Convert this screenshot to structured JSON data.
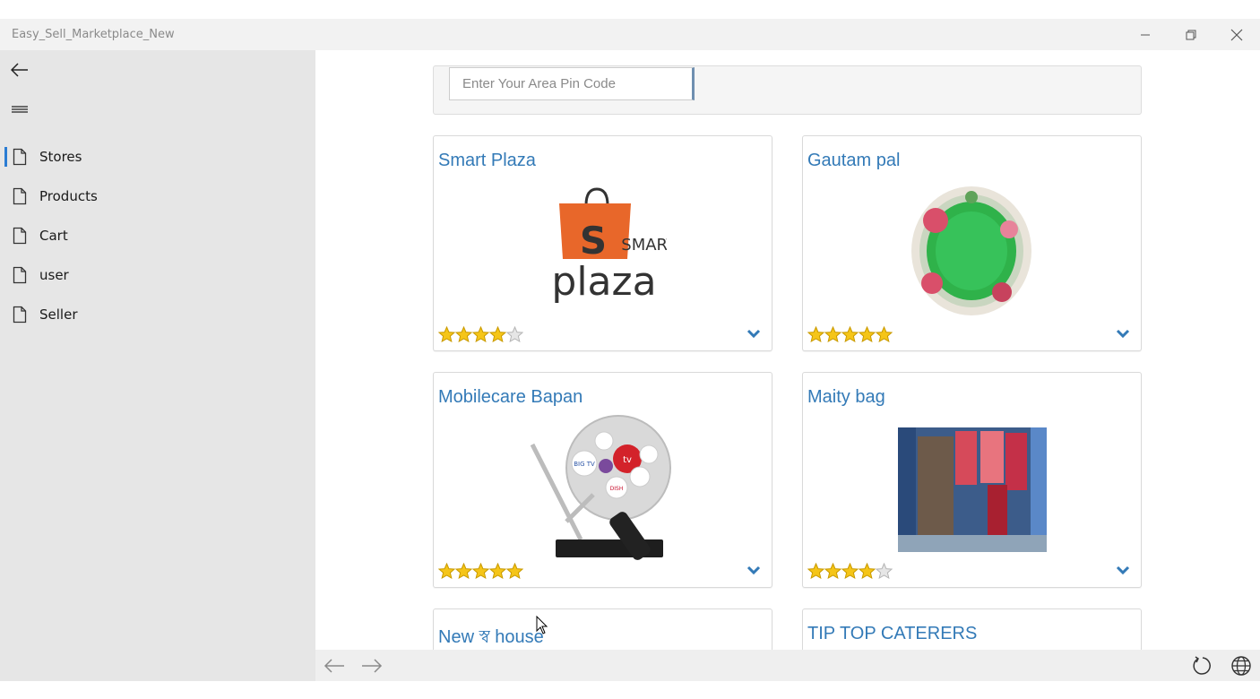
{
  "window": {
    "title": "Easy_Sell_Marketplace_New"
  },
  "sidebar": {
    "items": [
      {
        "label": "Stores",
        "icon": "page-icon",
        "selected": true
      },
      {
        "label": "Products",
        "icon": "page-icon",
        "selected": false
      },
      {
        "label": "Cart",
        "icon": "page-icon",
        "selected": false
      },
      {
        "label": "user",
        "icon": "page-icon",
        "selected": false
      },
      {
        "label": "Seller",
        "icon": "page-icon",
        "selected": false
      }
    ]
  },
  "search": {
    "placeholder": "Enter Your Area Pin Code"
  },
  "stores": [
    {
      "name": "Smart Plaza",
      "rating": 4,
      "image": "smart-plaza-logo"
    },
    {
      "name": "Gautam pal",
      "rating": 5,
      "image": "decorative-plate"
    },
    {
      "name": "Mobilecare Bapan",
      "rating": 5,
      "image": "satellite-dish"
    },
    {
      "name": "Maity bag",
      "rating": 4,
      "image": "bag-shop-photo"
    },
    {
      "name": "New স্ব house",
      "rating": null,
      "image": ""
    },
    {
      "name": "TIP TOP CATERERS",
      "rating": null,
      "image": ""
    }
  ],
  "logo_text": {
    "top": "SMART",
    "bottom": "plaza"
  },
  "dish_labels": [
    "BIG TV",
    "tv",
    "DISH"
  ],
  "colors": {
    "accent": "#2b7cd3",
    "store_name": "#337ab7",
    "star": "#f5c518"
  }
}
